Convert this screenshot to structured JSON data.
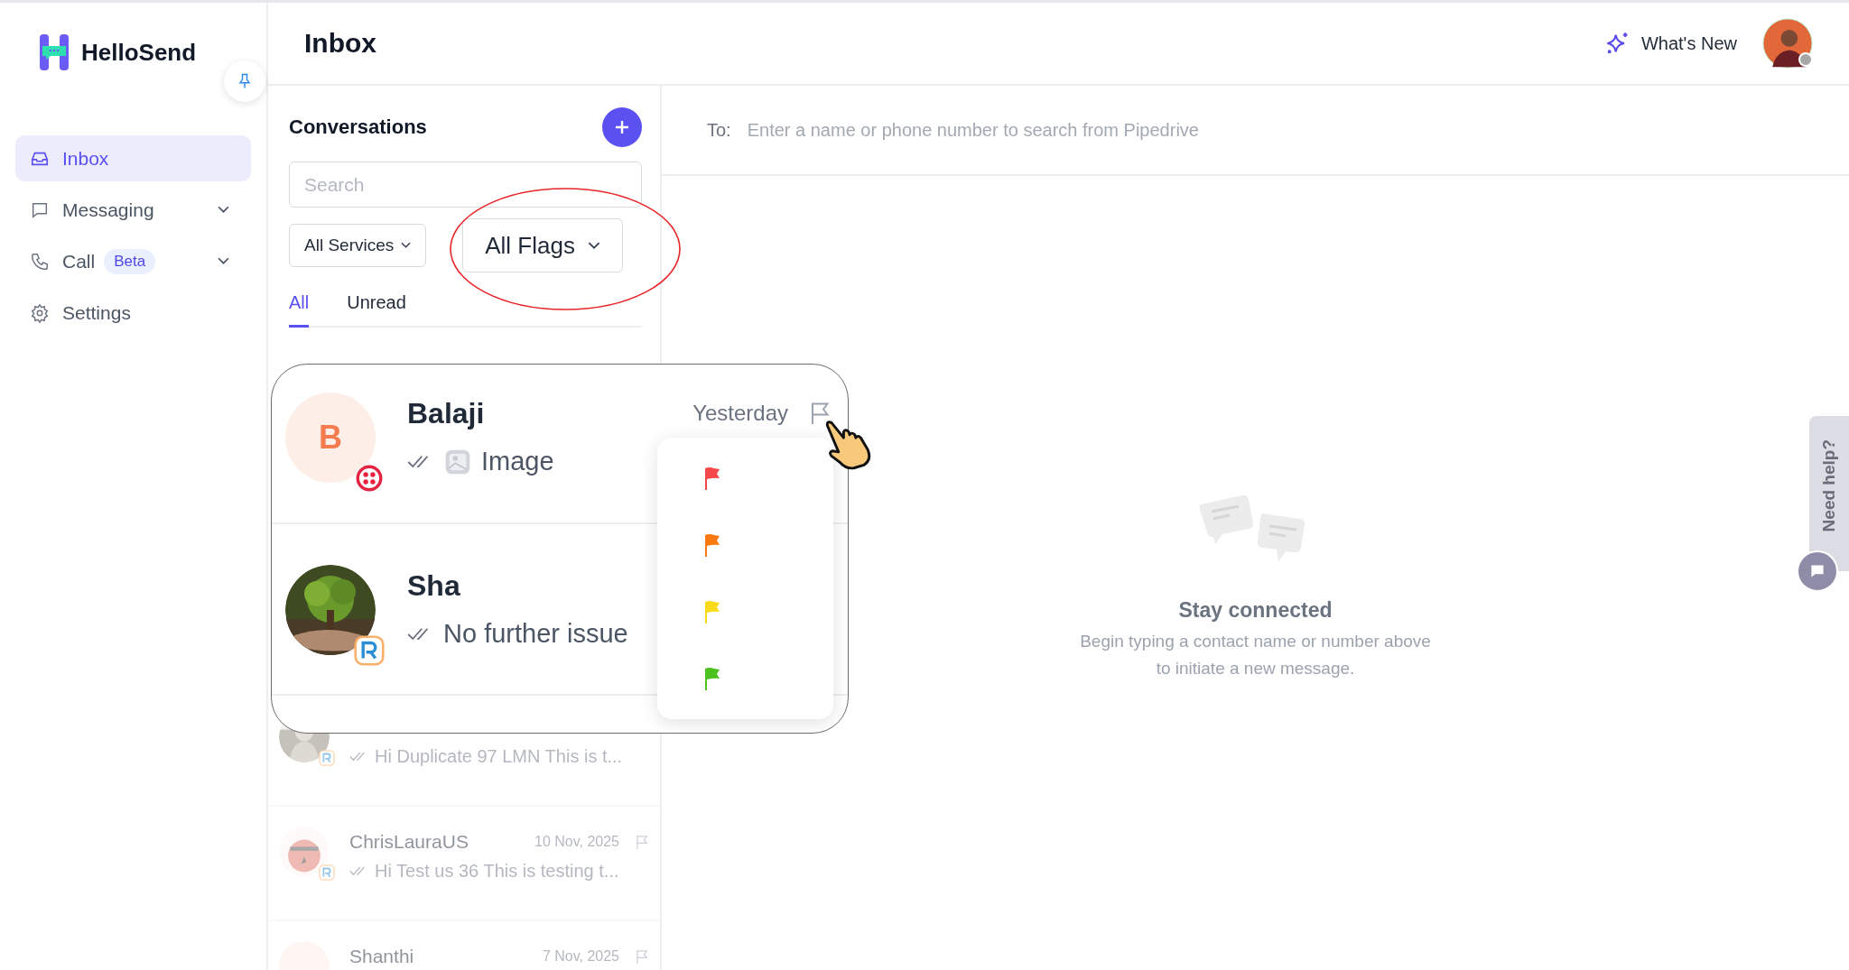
{
  "app": {
    "name": "HelloSend"
  },
  "sidebar": {
    "items": [
      {
        "label": "Inbox",
        "selected": true,
        "has_submenu": false
      },
      {
        "label": "Messaging",
        "selected": false,
        "has_submenu": true
      },
      {
        "label": "Call",
        "badge": "Beta",
        "selected": false,
        "has_submenu": true
      },
      {
        "label": "Settings",
        "selected": false,
        "has_submenu": false
      }
    ]
  },
  "header": {
    "title": "Inbox",
    "whats_new": "What's New"
  },
  "conversations": {
    "title": "Conversations",
    "search": {
      "placeholder": "Search"
    },
    "filters": [
      {
        "label": "All Services",
        "highlighted": false
      },
      {
        "label": "All Flags",
        "highlighted": true
      }
    ],
    "tabs": [
      {
        "label": "All",
        "selected": true
      },
      {
        "label": "Unread",
        "selected": false
      }
    ],
    "rows": [
      {
        "channel": {
          "kind": "r"
        },
        "message": "Hi Duplicate 97 LMN This is t..."
      },
      {
        "channel": {
          "kind": "r"
        },
        "name": "ChrisLauraUS",
        "date": "10 Nov, 2025",
        "message": "Hi Test us 36 This is testing t..."
      },
      {
        "avatar": {
          "kind": "initial"
        },
        "name": "Shanthi",
        "date": "7 Nov, 2025"
      }
    ]
  },
  "magnifier": {
    "rows": [
      {
        "avatar": {
          "kind": "initial",
          "initial": "B"
        },
        "channel": {
          "kind": "twilio"
        },
        "name": "Balaji",
        "date": "Yesterday",
        "has_image": true,
        "message": "Image"
      },
      {
        "channel": {
          "kind": "r"
        },
        "name": "Sha",
        "has_image": false,
        "message": "No further issue"
      }
    ],
    "flag_options": [
      {
        "color": "#f5484a"
      },
      {
        "color": "#fb7a10"
      },
      {
        "color": "#fadb1c"
      },
      {
        "color": "#4cc21e"
      }
    ]
  },
  "compose": {
    "to_label": "To:",
    "placeholder": "Enter a name or phone number to search from Pipedrive"
  },
  "empty_state": {
    "title": "Stay connected",
    "text": "Begin typing a contact name or number above to initiate a new message."
  },
  "help_tab": {
    "label": "Need help?"
  }
}
